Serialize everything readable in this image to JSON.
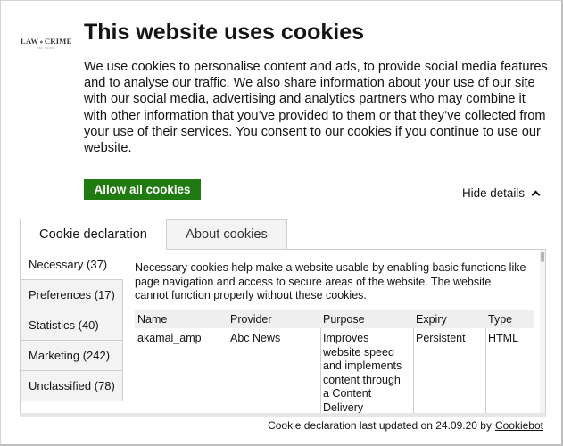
{
  "brand": {
    "logo_text_left": "LAW",
    "logo_text_right": "CRIME",
    "logo_subtext": "ABC NEWS"
  },
  "dialog": {
    "title": "This website uses cookies",
    "intro": "We use cookies to personalise content and ads, to provide social media features and to analyse our traffic. We also share information about your use of our site with our social media, advertising and analytics partners who may combine it with other information that you’ve provided to them or that they’ve collected from your use of their services. You consent to our cookies if you continue to use our website.",
    "allow_all_label": "Allow all cookies",
    "hide_details_label": "Hide details"
  },
  "tabs": [
    {
      "label": "Cookie declaration",
      "active": true
    },
    {
      "label": "About cookies",
      "active": false
    }
  ],
  "categories": [
    {
      "label": "Necessary (37)",
      "active": true
    },
    {
      "label": "Preferences (17)",
      "active": false
    },
    {
      "label": "Statistics (40)",
      "active": false
    },
    {
      "label": "Marketing (242)",
      "active": false
    },
    {
      "label": "Unclassified (78)",
      "active": false
    }
  ],
  "necessary": {
    "description": "Necessary cookies help make a website usable by enabling basic functions like page navigation and access to secure areas of the website. The website cannot function properly without these cookies.",
    "columns": [
      "Name",
      "Provider",
      "Purpose",
      "Expiry",
      "Type"
    ],
    "rows": [
      {
        "name": "akamai_amp",
        "provider": "Abc News",
        "purpose": "Improves website speed and implements content through a Content Delivery",
        "expiry": "Persistent",
        "type": "HTML"
      }
    ]
  },
  "footer": {
    "text": "Cookie declaration last updated on 24.09.20 by",
    "link": "Cookiebot"
  },
  "colors": {
    "accent_green": "#1f7a10",
    "text": "#141414",
    "border": "#cfcfcf"
  }
}
